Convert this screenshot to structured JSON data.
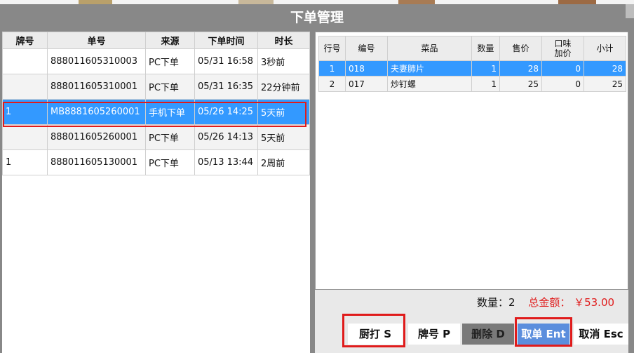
{
  "window": {
    "title": "下单管理"
  },
  "orders": {
    "headers": [
      "牌号",
      "单号",
      "来源",
      "下单时间",
      "时长"
    ],
    "rows": [
      {
        "plate": "",
        "order_no": "888011605310003",
        "source": "PC下单",
        "time": "05/31 16:58",
        "duration": "3秒前"
      },
      {
        "plate": "",
        "order_no": "888011605310001",
        "source": "PC下单",
        "time": "05/31 16:35",
        "duration": "22分钟前"
      },
      {
        "plate": "1",
        "order_no": "MB8881605260001",
        "source": "手机下单",
        "time": "05/26 14:25",
        "duration": "5天前"
      },
      {
        "plate": "",
        "order_no": "888011605260001",
        "source": "PC下单",
        "time": "05/26 14:13",
        "duration": "5天前"
      },
      {
        "plate": "1",
        "order_no": "888011605130001",
        "source": "PC下单",
        "time": "05/13 13:44",
        "duration": "2周前"
      }
    ]
  },
  "items": {
    "headers": {
      "line": "行号",
      "code": "编号",
      "dish": "菜品",
      "qty": "数量",
      "price": "售价",
      "extra_1": "口味",
      "extra_2": "加价",
      "subtotal": "小计"
    },
    "rows": [
      {
        "line": "1",
        "code": "018",
        "dish": "夫妻肺片",
        "qty": "1",
        "price": "28",
        "extra": "0",
        "subtotal": "28"
      },
      {
        "line": "2",
        "code": "017",
        "dish": "炒钉螺",
        "qty": "1",
        "price": "25",
        "extra": "0",
        "subtotal": "25"
      }
    ]
  },
  "summary": {
    "quantity": "数量：2",
    "total": "总金额： ￥53.00"
  },
  "buttons": {
    "kitchen": "厨打 S",
    "plate": "牌号 P",
    "delete": "删除 D",
    "take": "取单 Ent",
    "cancel": "取消 Esc"
  },
  "colors": {
    "selection": "#3399ff",
    "highlight": "#e01b1b",
    "title_bar": "#888888",
    "take_button": "#5b8edd"
  }
}
